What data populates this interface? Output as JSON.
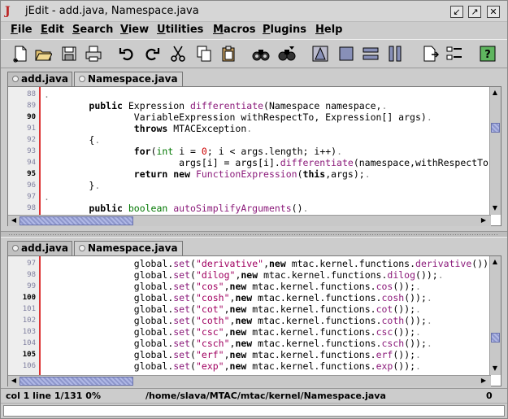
{
  "window": {
    "title": "jEdit - add.java, Namespace.java",
    "app_icon": "J",
    "buttons": [
      "↙",
      "↗",
      "✕"
    ]
  },
  "menu": [
    {
      "first": "F",
      "rest": "ile"
    },
    {
      "first": "E",
      "rest": "dit"
    },
    {
      "first": "S",
      "rest": "earch"
    },
    {
      "first": "V",
      "rest": "iew"
    },
    {
      "first": "U",
      "rest": "tilities"
    },
    {
      "first": "M",
      "rest": "acros"
    },
    {
      "first": "P",
      "rest": "lugins"
    },
    {
      "first": "H",
      "rest": "elp"
    }
  ],
  "toolbar_icons": [
    "new-file-icon",
    "open-file-icon",
    "save-icon",
    "print-icon",
    "undo-icon",
    "redo-icon",
    "cut-icon",
    "copy-icon",
    "paste-icon",
    "find-icon",
    "find-next-icon",
    "split-icon",
    "unsplit-icon",
    "horizontal-split-icon",
    "vertical-split-icon",
    "buffer-icon",
    "options-icon",
    "help-icon"
  ],
  "top_pane": {
    "tabs": [
      "add.java",
      "Namespace.java"
    ],
    "active_tab": 1,
    "lines": [
      {
        "n": "88",
        "bold": false,
        "segs": [
          [
            "dotsm",
            "."
          ]
        ]
      },
      {
        "n": "89",
        "bold": false,
        "segs": [
          [
            "",
            "        "
          ],
          [
            "kw",
            "public "
          ],
          [
            "",
            "Expression "
          ],
          [
            "fn",
            "differentiate"
          ],
          [
            "",
            "(Namespace namespace,"
          ],
          [
            "dotsm",
            "."
          ]
        ]
      },
      {
        "n": "90",
        "bold": true,
        "segs": [
          [
            "",
            "                VariableExpression withRespectTo, Expression[] args)"
          ],
          [
            "dotsm",
            "."
          ]
        ]
      },
      {
        "n": "91",
        "bold": false,
        "segs": [
          [
            "",
            "                "
          ],
          [
            "kw",
            "throws "
          ],
          [
            "",
            "MTACException"
          ],
          [
            "dotsm",
            "."
          ]
        ]
      },
      {
        "n": "92",
        "bold": false,
        "segs": [
          [
            "",
            "        {"
          ],
          [
            "dotsm",
            "."
          ]
        ]
      },
      {
        "n": "93",
        "bold": false,
        "segs": [
          [
            "",
            "                "
          ],
          [
            "kw",
            "for"
          ],
          [
            "",
            "("
          ],
          [
            "prim",
            "int "
          ],
          [
            "",
            "i = "
          ],
          [
            "num",
            "0"
          ],
          [
            "",
            "; i < args.length; i++)"
          ],
          [
            "dotsm",
            "."
          ]
        ]
      },
      {
        "n": "94",
        "bold": false,
        "segs": [
          [
            "",
            "                        args[i] = args[i]."
          ],
          [
            "fn",
            "differentiate"
          ],
          [
            "",
            "(namespace,withRespectTo"
          ]
        ]
      },
      {
        "n": "95",
        "bold": true,
        "segs": [
          [
            "",
            "                "
          ],
          [
            "kw",
            "return new "
          ],
          [
            "fn",
            "FunctionExpression"
          ],
          [
            "",
            "("
          ],
          [
            "kw",
            "this"
          ],
          [
            "",
            ",args);"
          ],
          [
            "dotsm",
            "."
          ]
        ]
      },
      {
        "n": "96",
        "bold": false,
        "segs": [
          [
            "",
            "        }"
          ],
          [
            "dotsm",
            "."
          ]
        ]
      },
      {
        "n": "97",
        "bold": false,
        "segs": [
          [
            "dotsm",
            "."
          ]
        ]
      },
      {
        "n": "98",
        "bold": false,
        "segs": [
          [
            "",
            "        "
          ],
          [
            "kw",
            "public "
          ],
          [
            "prim",
            "boolean "
          ],
          [
            "fn",
            "autoSimplifyArguments"
          ],
          [
            "",
            "()"
          ],
          [
            "dotsm",
            "."
          ]
        ]
      }
    ]
  },
  "bottom_pane": {
    "tabs": [
      "add.java",
      "Namespace.java"
    ],
    "active_tab": 1,
    "lines": [
      {
        "n": "97",
        "bold": false,
        "segs": [
          [
            "",
            "                global."
          ],
          [
            "fn",
            "set"
          ],
          [
            "",
            "("
          ],
          [
            "str",
            "\"derivative\""
          ],
          [
            "",
            ","
          ],
          [
            "kw",
            "new "
          ],
          [
            "",
            "mtac.kernel.functions."
          ],
          [
            "fn",
            "derivative"
          ],
          [
            "",
            "())"
          ]
        ]
      },
      {
        "n": "98",
        "bold": false,
        "segs": [
          [
            "",
            "                global."
          ],
          [
            "fn",
            "set"
          ],
          [
            "",
            "("
          ],
          [
            "str",
            "\"dilog\""
          ],
          [
            "",
            ","
          ],
          [
            "kw",
            "new "
          ],
          [
            "",
            "mtac.kernel.functions."
          ],
          [
            "fn",
            "dilog"
          ],
          [
            "",
            "());"
          ],
          [
            "dotsm",
            "."
          ]
        ]
      },
      {
        "n": "99",
        "bold": false,
        "segs": [
          [
            "",
            "                global."
          ],
          [
            "fn",
            "set"
          ],
          [
            "",
            "("
          ],
          [
            "str",
            "\"cos\""
          ],
          [
            "",
            ","
          ],
          [
            "kw",
            "new "
          ],
          [
            "",
            "mtac.kernel.functions."
          ],
          [
            "fn",
            "cos"
          ],
          [
            "",
            "());"
          ],
          [
            "dotsm",
            "."
          ]
        ]
      },
      {
        "n": "100",
        "bold": true,
        "segs": [
          [
            "",
            "                global."
          ],
          [
            "fn",
            "set"
          ],
          [
            "",
            "("
          ],
          [
            "str",
            "\"cosh\""
          ],
          [
            "",
            ","
          ],
          [
            "kw",
            "new "
          ],
          [
            "",
            "mtac.kernel.functions."
          ],
          [
            "fn",
            "cosh"
          ],
          [
            "",
            "());"
          ],
          [
            "dotsm",
            "."
          ]
        ]
      },
      {
        "n": "101",
        "bold": false,
        "segs": [
          [
            "",
            "                global."
          ],
          [
            "fn",
            "set"
          ],
          [
            "",
            "("
          ],
          [
            "str",
            "\"cot\""
          ],
          [
            "",
            ","
          ],
          [
            "kw",
            "new "
          ],
          [
            "",
            "mtac.kernel.functions."
          ],
          [
            "fn",
            "cot"
          ],
          [
            "",
            "());"
          ],
          [
            "dotsm",
            "."
          ]
        ]
      },
      {
        "n": "102",
        "bold": false,
        "segs": [
          [
            "",
            "                global."
          ],
          [
            "fn",
            "set"
          ],
          [
            "",
            "("
          ],
          [
            "str",
            "\"coth\""
          ],
          [
            "",
            ","
          ],
          [
            "kw",
            "new "
          ],
          [
            "",
            "mtac.kernel.functions."
          ],
          [
            "fn",
            "coth"
          ],
          [
            "",
            "());"
          ],
          [
            "dotsm",
            "."
          ]
        ]
      },
      {
        "n": "103",
        "bold": false,
        "segs": [
          [
            "",
            "                global."
          ],
          [
            "fn",
            "set"
          ],
          [
            "",
            "("
          ],
          [
            "str",
            "\"csc\""
          ],
          [
            "",
            ","
          ],
          [
            "kw",
            "new "
          ],
          [
            "",
            "mtac.kernel.functions."
          ],
          [
            "fn",
            "csc"
          ],
          [
            "",
            "());"
          ],
          [
            "dotsm",
            "."
          ]
        ]
      },
      {
        "n": "104",
        "bold": false,
        "segs": [
          [
            "",
            "                global."
          ],
          [
            "fn",
            "set"
          ],
          [
            "",
            "("
          ],
          [
            "str",
            "\"csch\""
          ],
          [
            "",
            ","
          ],
          [
            "kw",
            "new "
          ],
          [
            "",
            "mtac.kernel.functions."
          ],
          [
            "fn",
            "csch"
          ],
          [
            "",
            "());"
          ],
          [
            "dotsm",
            "."
          ]
        ]
      },
      {
        "n": "105",
        "bold": true,
        "segs": [
          [
            "",
            "                global."
          ],
          [
            "fn",
            "set"
          ],
          [
            "",
            "("
          ],
          [
            "str",
            "\"erf\""
          ],
          [
            "",
            ","
          ],
          [
            "kw",
            "new "
          ],
          [
            "",
            "mtac.kernel.functions."
          ],
          [
            "fn",
            "erf"
          ],
          [
            "",
            "());"
          ],
          [
            "dotsm",
            "."
          ]
        ]
      },
      {
        "n": "106",
        "bold": false,
        "segs": [
          [
            "",
            "                global."
          ],
          [
            "fn",
            "set"
          ],
          [
            "",
            "("
          ],
          [
            "str",
            "\"exp\""
          ],
          [
            "",
            ","
          ],
          [
            "kw",
            "new "
          ],
          [
            "",
            "mtac.kernel.functions."
          ],
          [
            "fn",
            "exp"
          ],
          [
            "",
            "());"
          ],
          [
            "dotsm",
            "."
          ]
        ]
      }
    ]
  },
  "status": {
    "position": "col 1 line 1/131 0%",
    "path": "/home/slava/MTAC/mtac/kernel/Namespace.java",
    "right": "0"
  },
  "scroll_arrows": {
    "up": "▲",
    "down": "▼",
    "left": "◀",
    "right": "▶"
  }
}
